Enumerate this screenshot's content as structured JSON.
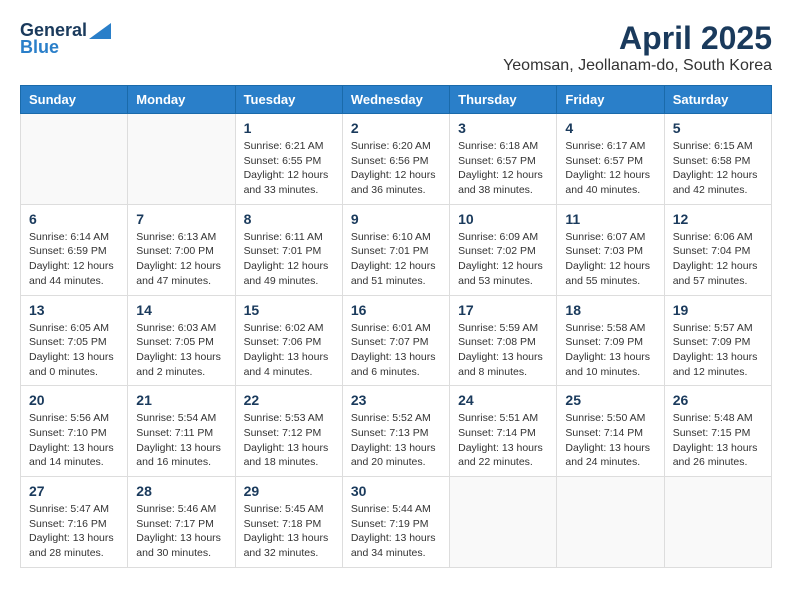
{
  "logo": {
    "general": "General",
    "blue": "Blue"
  },
  "title": "April 2025",
  "location": "Yeomsan, Jeollanam-do, South Korea",
  "days_of_week": [
    "Sunday",
    "Monday",
    "Tuesday",
    "Wednesday",
    "Thursday",
    "Friday",
    "Saturday"
  ],
  "weeks": [
    [
      {
        "day": "",
        "info": ""
      },
      {
        "day": "",
        "info": ""
      },
      {
        "day": "1",
        "info": "Sunrise: 6:21 AM\nSunset: 6:55 PM\nDaylight: 12 hours and 33 minutes."
      },
      {
        "day": "2",
        "info": "Sunrise: 6:20 AM\nSunset: 6:56 PM\nDaylight: 12 hours and 36 minutes."
      },
      {
        "day": "3",
        "info": "Sunrise: 6:18 AM\nSunset: 6:57 PM\nDaylight: 12 hours and 38 minutes."
      },
      {
        "day": "4",
        "info": "Sunrise: 6:17 AM\nSunset: 6:57 PM\nDaylight: 12 hours and 40 minutes."
      },
      {
        "day": "5",
        "info": "Sunrise: 6:15 AM\nSunset: 6:58 PM\nDaylight: 12 hours and 42 minutes."
      }
    ],
    [
      {
        "day": "6",
        "info": "Sunrise: 6:14 AM\nSunset: 6:59 PM\nDaylight: 12 hours and 44 minutes."
      },
      {
        "day": "7",
        "info": "Sunrise: 6:13 AM\nSunset: 7:00 PM\nDaylight: 12 hours and 47 minutes."
      },
      {
        "day": "8",
        "info": "Sunrise: 6:11 AM\nSunset: 7:01 PM\nDaylight: 12 hours and 49 minutes."
      },
      {
        "day": "9",
        "info": "Sunrise: 6:10 AM\nSunset: 7:01 PM\nDaylight: 12 hours and 51 minutes."
      },
      {
        "day": "10",
        "info": "Sunrise: 6:09 AM\nSunset: 7:02 PM\nDaylight: 12 hours and 53 minutes."
      },
      {
        "day": "11",
        "info": "Sunrise: 6:07 AM\nSunset: 7:03 PM\nDaylight: 12 hours and 55 minutes."
      },
      {
        "day": "12",
        "info": "Sunrise: 6:06 AM\nSunset: 7:04 PM\nDaylight: 12 hours and 57 minutes."
      }
    ],
    [
      {
        "day": "13",
        "info": "Sunrise: 6:05 AM\nSunset: 7:05 PM\nDaylight: 13 hours and 0 minutes."
      },
      {
        "day": "14",
        "info": "Sunrise: 6:03 AM\nSunset: 7:05 PM\nDaylight: 13 hours and 2 minutes."
      },
      {
        "day": "15",
        "info": "Sunrise: 6:02 AM\nSunset: 7:06 PM\nDaylight: 13 hours and 4 minutes."
      },
      {
        "day": "16",
        "info": "Sunrise: 6:01 AM\nSunset: 7:07 PM\nDaylight: 13 hours and 6 minutes."
      },
      {
        "day": "17",
        "info": "Sunrise: 5:59 AM\nSunset: 7:08 PM\nDaylight: 13 hours and 8 minutes."
      },
      {
        "day": "18",
        "info": "Sunrise: 5:58 AM\nSunset: 7:09 PM\nDaylight: 13 hours and 10 minutes."
      },
      {
        "day": "19",
        "info": "Sunrise: 5:57 AM\nSunset: 7:09 PM\nDaylight: 13 hours and 12 minutes."
      }
    ],
    [
      {
        "day": "20",
        "info": "Sunrise: 5:56 AM\nSunset: 7:10 PM\nDaylight: 13 hours and 14 minutes."
      },
      {
        "day": "21",
        "info": "Sunrise: 5:54 AM\nSunset: 7:11 PM\nDaylight: 13 hours and 16 minutes."
      },
      {
        "day": "22",
        "info": "Sunrise: 5:53 AM\nSunset: 7:12 PM\nDaylight: 13 hours and 18 minutes."
      },
      {
        "day": "23",
        "info": "Sunrise: 5:52 AM\nSunset: 7:13 PM\nDaylight: 13 hours and 20 minutes."
      },
      {
        "day": "24",
        "info": "Sunrise: 5:51 AM\nSunset: 7:14 PM\nDaylight: 13 hours and 22 minutes."
      },
      {
        "day": "25",
        "info": "Sunrise: 5:50 AM\nSunset: 7:14 PM\nDaylight: 13 hours and 24 minutes."
      },
      {
        "day": "26",
        "info": "Sunrise: 5:48 AM\nSunset: 7:15 PM\nDaylight: 13 hours and 26 minutes."
      }
    ],
    [
      {
        "day": "27",
        "info": "Sunrise: 5:47 AM\nSunset: 7:16 PM\nDaylight: 13 hours and 28 minutes."
      },
      {
        "day": "28",
        "info": "Sunrise: 5:46 AM\nSunset: 7:17 PM\nDaylight: 13 hours and 30 minutes."
      },
      {
        "day": "29",
        "info": "Sunrise: 5:45 AM\nSunset: 7:18 PM\nDaylight: 13 hours and 32 minutes."
      },
      {
        "day": "30",
        "info": "Sunrise: 5:44 AM\nSunset: 7:19 PM\nDaylight: 13 hours and 34 minutes."
      },
      {
        "day": "",
        "info": ""
      },
      {
        "day": "",
        "info": ""
      },
      {
        "day": "",
        "info": ""
      }
    ]
  ]
}
